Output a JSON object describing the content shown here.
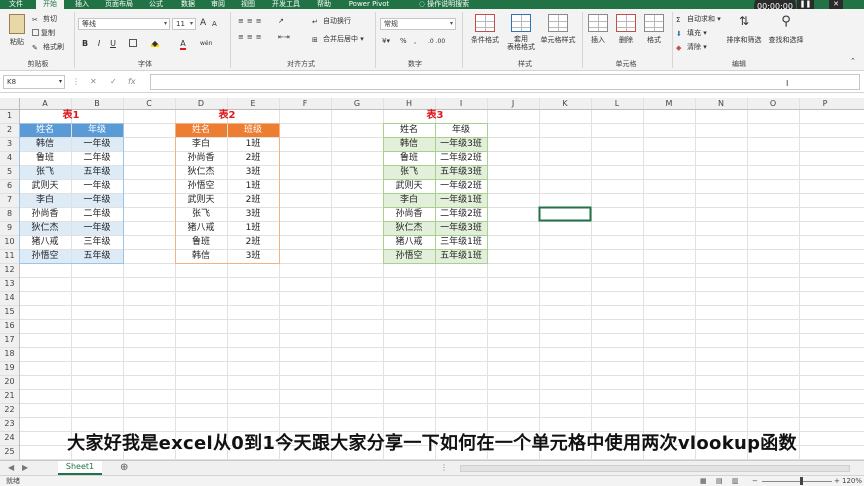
{
  "tabs": [
    "文件",
    "开始",
    "插入",
    "页面布局",
    "公式",
    "数据",
    "审阅",
    "视图",
    "开发工具",
    "帮助",
    "Power Pivot",
    "操作说明搜索"
  ],
  "active_tab": 1,
  "ribbon": {
    "clipboard": {
      "cut": "剪切",
      "copy": "复制",
      "format_painter": "格式刷",
      "paste": "粘贴",
      "label": "剪贴板"
    },
    "font": {
      "name": "等线",
      "size": "11",
      "bold": "B",
      "italic": "I",
      "underline": "U",
      "grow": "A",
      "shrink": "A",
      "font_color_letter": "A",
      "wen": "wén",
      "label": "字体"
    },
    "alignment": {
      "wrap": "自动换行",
      "merge": "合并后居中",
      "label": "对齐方式"
    },
    "number": {
      "format": "常规",
      "percent": "%",
      "comma": ",",
      "label": "数字"
    },
    "styles": {
      "conditional": "条件格式",
      "table_l1": "套用",
      "table_l2": "表格格式",
      "cell_styles": "单元格样式",
      "label": "样式"
    },
    "cells": {
      "insert": "插入",
      "delete": "删除",
      "format": "格式",
      "label": "单元格"
    },
    "editing": {
      "autosum": "自动求和",
      "fill": "填充",
      "clear": "清除",
      "sort": "排序和筛选",
      "find": "查找和选择",
      "label": "编辑"
    }
  },
  "overlay": {
    "timer": "00:00:00",
    "pause": "❚❚"
  },
  "formula_bar": {
    "name_box": "K8",
    "cancel": "✕",
    "enter": "✓",
    "fx": "fx",
    "formula": ""
  },
  "columns": [
    "A",
    "B",
    "C",
    "D",
    "E",
    "F",
    "G",
    "H",
    "I",
    "J",
    "K",
    "L",
    "M",
    "N",
    "O",
    "P"
  ],
  "rows": [
    1,
    2,
    3,
    4,
    5,
    6,
    7,
    8,
    9,
    10,
    11,
    12,
    13,
    14,
    15,
    16,
    17,
    18,
    19,
    20,
    21,
    22,
    23,
    24,
    25,
    26
  ],
  "table1": {
    "title": "表1",
    "headers": [
      "姓名",
      "年级"
    ],
    "rows": [
      [
        "韩信",
        "一年级"
      ],
      [
        "鲁班",
        "二年级"
      ],
      [
        "张飞",
        "五年级"
      ],
      [
        "武则天",
        "一年级"
      ],
      [
        "李白",
        "一年级"
      ],
      [
        "孙尚香",
        "二年级"
      ],
      [
        "狄仁杰",
        "一年级"
      ],
      [
        "猪八戒",
        "三年级"
      ],
      [
        "孙悟空",
        "五年级"
      ]
    ]
  },
  "table2": {
    "title": "表2",
    "headers": [
      "姓名",
      "班级"
    ],
    "rows": [
      [
        "李白",
        "1班"
      ],
      [
        "孙尚香",
        "2班"
      ],
      [
        "狄仁杰",
        "3班"
      ],
      [
        "孙悟空",
        "1班"
      ],
      [
        "武则天",
        "2班"
      ],
      [
        "张飞",
        "3班"
      ],
      [
        "猪八戒",
        "1班"
      ],
      [
        "鲁班",
        "2班"
      ],
      [
        "韩信",
        "3班"
      ]
    ]
  },
  "table3": {
    "title": "表3",
    "headers": [
      "姓名",
      "年级"
    ],
    "rows": [
      [
        "韩信",
        "一年级3班"
      ],
      [
        "鲁班",
        "二年级2班"
      ],
      [
        "张飞",
        "五年级3班"
      ],
      [
        "武则天",
        "一年级2班"
      ],
      [
        "李白",
        "一年级1班"
      ],
      [
        "孙尚香",
        "二年级2班"
      ],
      [
        "狄仁杰",
        "一年级3班"
      ],
      [
        "猪八戒",
        "三年级1班"
      ],
      [
        "孙悟空",
        "五年级1班"
      ]
    ]
  },
  "subtitle": "大家好我是excel从0到1今天跟大家分享一下如何在一个单元格中使用两次vlookup函数",
  "sheet_tab": "Sheet1",
  "add_sheet": "⊕",
  "status": {
    "ready": "就绪",
    "zoom": "120%"
  },
  "colors": {
    "excel_green": "#217346",
    "blue_header": "#5b9bd5",
    "blue_band": "#ddebf7",
    "orange_header": "#ed7d31",
    "green_band": "#e2efda",
    "title_red": "#e0191c"
  }
}
